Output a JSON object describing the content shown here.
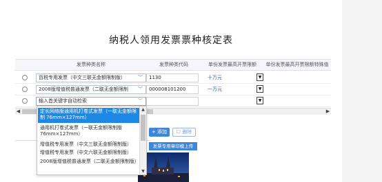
{
  "title": "纳税人领用发票票种核定表",
  "table": {
    "headers": [
      "发票种类名称",
      "发票种类代码",
      "单份发票最高开票限额",
      "单份发票最高开票限额特殊值"
    ],
    "rows": [
      {
        "name": "百税专用发票（中文三联无金额限制版）",
        "code": "1130",
        "limit": "十万元"
      },
      {
        "name": "2008版增值税普通发票（二联无金额限制",
        "code": "000008101200",
        "limit": "一万元"
      },
      {
        "name_placeholder": "输入首关键字自动检索",
        "code": "",
        "limit": ""
      }
    ]
  },
  "dropdown": {
    "options": [
      "定长网络版通用机打卷式发票（一联无金额限制 76mm×127mm）",
      "通用机打卷式发票（一联无金额限制版 76mm×127mm）",
      "增值税专用发票（中文三联无金额限制版）",
      "增值税专用发票（中文六联无金额限制版）",
      "2008版增值税普通发票（二联无金额限制版）"
    ]
  },
  "actions": {
    "add_label": "+ 添加",
    "delete_label": "☐ 删除",
    "upload_label": "发票专用章印模上传"
  },
  "icons": {
    "chevron": "chevron-down-icon",
    "scroll_left": "◀",
    "scroll_right": "▶"
  },
  "colors": {
    "accent": "#3f86d8",
    "highlight": "#1e88e5"
  }
}
